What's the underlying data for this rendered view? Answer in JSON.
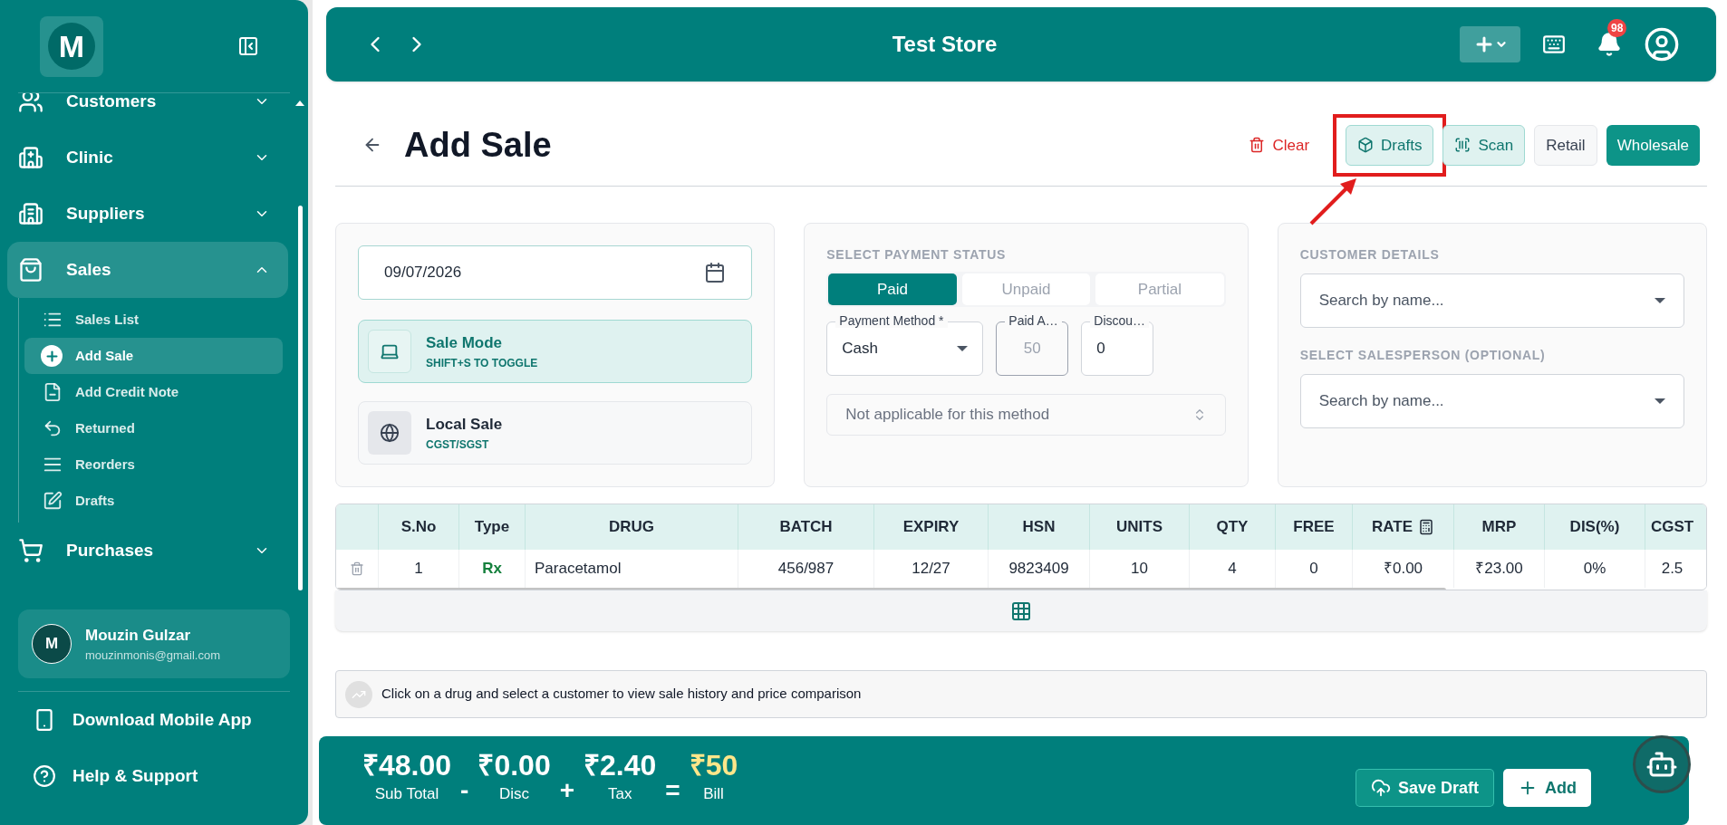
{
  "sidebar": {
    "logo": "M",
    "nav": [
      {
        "label": "Customers",
        "expanded": false,
        "selected": false
      },
      {
        "label": "Clinic",
        "expanded": false,
        "selected": false
      },
      {
        "label": "Suppliers",
        "expanded": false,
        "selected": false
      },
      {
        "label": "Sales",
        "expanded": true,
        "selected": true,
        "children": [
          {
            "label": "Sales List",
            "selected": false
          },
          {
            "label": "Add Sale",
            "selected": true
          },
          {
            "label": "Add Credit Note",
            "selected": false
          },
          {
            "label": "Returned",
            "selected": false
          },
          {
            "label": "Reorders",
            "selected": false
          },
          {
            "label": "Drafts",
            "selected": false
          }
        ]
      },
      {
        "label": "Purchases",
        "expanded": false,
        "selected": false
      }
    ],
    "user": {
      "initial": "M",
      "name": "Mouzin Gulzar",
      "email": "mouzinmonis@gmail.com"
    },
    "links": [
      "Download Mobile App",
      "Help & Support"
    ]
  },
  "header": {
    "title": "Test Store",
    "notification_count": "98"
  },
  "page": {
    "title": "Add Sale",
    "actions": [
      {
        "label": "Clear",
        "kind": "danger",
        "annotated": false
      },
      {
        "label": "Drafts",
        "kind": "soft",
        "annotated": true
      },
      {
        "label": "Scan",
        "kind": "soft",
        "annotated": false
      },
      {
        "label": "Retail",
        "kind": "plain",
        "annotated": false
      },
      {
        "label": "Wholesale",
        "kind": "primary",
        "annotated": false
      }
    ]
  },
  "sale_card": {
    "date": "09/07/2026",
    "modes": [
      {
        "title": "Sale Mode",
        "subtitle": "SHIFT+S TO TOGGLE",
        "selected": true
      },
      {
        "title": "Local Sale",
        "subtitle": "CGST/SGST",
        "selected": false
      }
    ]
  },
  "payment_card": {
    "heading": "SELECT PAYMENT STATUS",
    "statuses": [
      {
        "label": "Paid",
        "selected": true
      },
      {
        "label": "Unpaid",
        "selected": false
      },
      {
        "label": "Partial",
        "selected": false
      }
    ],
    "fields": [
      {
        "label": "Payment Method *",
        "value": "Cash",
        "kind": "select",
        "disabled": false
      },
      {
        "label": "Paid A…",
        "value": "50",
        "kind": "input",
        "disabled": true
      },
      {
        "label": "Discou…",
        "value": "0",
        "kind": "input",
        "disabled": false
      }
    ],
    "reference": {
      "placeholder": "Not applicable for this method",
      "disabled": true
    }
  },
  "customer_card": {
    "sections": [
      {
        "heading": "CUSTOMER DETAILS",
        "placeholder": "Search by name..."
      },
      {
        "heading": "SELECT SALESPERSON (OPTIONAL)",
        "placeholder": "Search by name..."
      }
    ]
  },
  "table": {
    "columns": [
      "S.No",
      "Type",
      "DRUG",
      "BATCH",
      "EXPIRY",
      "HSN",
      "UNITS",
      "QTY",
      "FREE",
      "RATE",
      "MRP",
      "DIS(%)",
      "CGST"
    ],
    "rows": [
      {
        "cells": [
          "1",
          "Rx",
          "Paracetamol",
          "456/987",
          "12/27",
          "9823409",
          "10",
          "4",
          "0",
          "₹0.00",
          "₹23.00",
          "0%",
          "2.5"
        ]
      }
    ]
  },
  "hint": "Click on a drug and select a customer to view sale history and price comparison",
  "totals": {
    "items": [
      {
        "value": "₹48.00",
        "label": "Sub Total",
        "kind": "amount"
      },
      {
        "value": "₹0.00",
        "label": "Disc",
        "kind": "amount"
      },
      {
        "value": "₹2.40",
        "label": "Tax",
        "kind": "amount"
      },
      {
        "value": "₹50",
        "label": "Bill",
        "kind": "bill"
      }
    ],
    "operators": [
      "-",
      "+",
      "="
    ],
    "buttons": [
      {
        "label": "Save Draft",
        "kind": "outline"
      },
      {
        "label": "Add",
        "kind": "solid"
      }
    ]
  }
}
